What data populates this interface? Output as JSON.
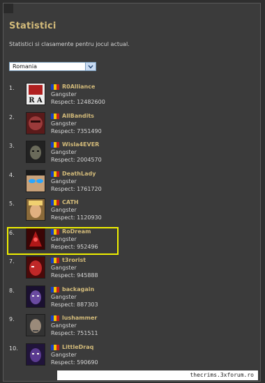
{
  "page": {
    "title": "Statistici",
    "subtitle": "Statistici si clasamente pentru jocul actual."
  },
  "country_select": {
    "selected": "Romania"
  },
  "colors": {
    "accent": "#d3bb7a",
    "highlight": "#f0f000",
    "flag": [
      "#1a3fbf",
      "#f2c700",
      "#c81e1e"
    ]
  },
  "leaderboard": [
    {
      "rank": "1.",
      "name": "R0Alliance",
      "title": "Gangster",
      "respect": "Respect: 12482600",
      "avatar": "ra-logo"
    },
    {
      "rank": "2.",
      "name": "AllBandits",
      "title": "Gangster",
      "respect": "Respect: 7351490",
      "avatar": "red-mask"
    },
    {
      "rank": "3.",
      "name": "Wisla4EVER",
      "title": "Gangster",
      "respect": "Respect: 2004570",
      "avatar": "dark-face"
    },
    {
      "rank": "4.",
      "name": "DeathLady",
      "title": "Gangster",
      "respect": "Respect: 1761720",
      "avatar": "blue-eyes"
    },
    {
      "rank": "5.",
      "name": "CATH",
      "title": "Gangster",
      "respect": "Respect: 1120930",
      "avatar": "blonde-face"
    },
    {
      "rank": "6.",
      "name": "RoDream",
      "title": "Gangster",
      "respect": "Respect: 952496",
      "avatar": "red-creature",
      "highlighted": true
    },
    {
      "rank": "7.",
      "name": "t3rorist",
      "title": "Gangster",
      "respect": "Respect: 945888",
      "avatar": "red-face"
    },
    {
      "rank": "8.",
      "name": "backagain",
      "title": "Gangster",
      "respect": "Respect: 887303",
      "avatar": "purple-face"
    },
    {
      "rank": "9.",
      "name": "lushammer",
      "title": "Gangster",
      "respect": "Respect: 751511",
      "avatar": "grey-face"
    },
    {
      "rank": "10.",
      "name": "LittleDraq",
      "title": "Gangster",
      "respect": "Respect: 590690",
      "avatar": "purple-face-2"
    }
  ],
  "footer": {
    "watermark": "thecrims.3xforum.ro"
  }
}
